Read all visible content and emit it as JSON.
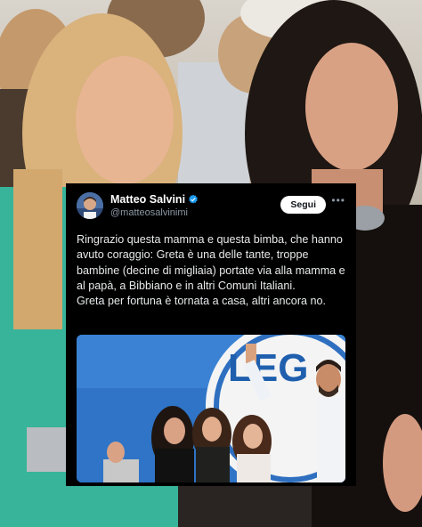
{
  "tweet": {
    "display_name": "Matteo Salvini",
    "handle": "@matteosalvinimi",
    "follow_label": "Segui",
    "more_icon": "more-horizontal-icon",
    "verified_icon": "verified-badge-icon",
    "body_line_1": "Ringrazio questa mamma e questa bimba, che hanno avuto coraggio: Greta è una delle tante, troppe bambine (decine di migliaia) portate via alla mamma e al papà, a Bibbiano e in altri Comuni Italiani.",
    "body_line_2": "Greta per fortuna è tornata a casa, altri ancora no.",
    "photo_banner_text": "LEG"
  },
  "colors": {
    "card_bg": "#000000",
    "text": "#e7e9ea",
    "handle": "#8b98a5",
    "verified": "#1d9bf0",
    "photo_bg": "#2f74c6"
  }
}
